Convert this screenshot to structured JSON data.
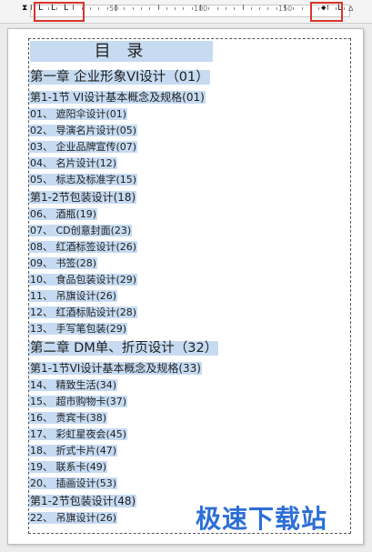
{
  "ruler": {
    "numbers": [
      "50",
      "100",
      "150"
    ]
  },
  "document": {
    "title": "目  录",
    "lines": [
      {
        "kind": "ch",
        "text": "第一章 企业形象VI设计（01）"
      },
      {
        "kind": "sec",
        "text": "第1-1节 VI设计基本概念及规格(01)"
      },
      {
        "kind": "it",
        "text": "01、 遮阳伞设计(01)"
      },
      {
        "kind": "it",
        "text": "02、 导演名片设计(05)"
      },
      {
        "kind": "it",
        "text": "03、 企业品牌宣传(07)"
      },
      {
        "kind": "it",
        "text": "04、 名片设计(12)"
      },
      {
        "kind": "it",
        "text": "05、 标志及标准字(15)"
      },
      {
        "kind": "sec",
        "text": "第1-2节包装设计(18)"
      },
      {
        "kind": "it",
        "text": "06、 酒瓶(19)"
      },
      {
        "kind": "it",
        "text": "07、 CD创意封面(23)"
      },
      {
        "kind": "it",
        "text": "08、 红酒标签设计(26)"
      },
      {
        "kind": "it",
        "text": "09、 书签(28)"
      },
      {
        "kind": "it",
        "text": "10、 食品包装设计(29)"
      },
      {
        "kind": "it",
        "text": "11、 吊旗设计(26)"
      },
      {
        "kind": "it",
        "text": "12、 红酒标贴设计(28)"
      },
      {
        "kind": "it",
        "text": "13、 手写笔包装(29)"
      },
      {
        "kind": "ch",
        "text": "第二章 DM单、折页设计（32）"
      },
      {
        "kind": "sec",
        "text": "第1-1节VI设计基本概念及规格(33)"
      },
      {
        "kind": "it",
        "text": "14、 精致生活(34)"
      },
      {
        "kind": "it",
        "text": "15、 超市购物卡(37)"
      },
      {
        "kind": "it",
        "text": "16、 贵宾卡(38)"
      },
      {
        "kind": "it",
        "text": "17、 彩虹星夜会(45)"
      },
      {
        "kind": "it",
        "text": "18、 折式卡片(47)"
      },
      {
        "kind": "it",
        "text": "19、 联系卡(49)"
      },
      {
        "kind": "it",
        "text": "20、 插画设计(53)"
      },
      {
        "kind": "sec",
        "text": "第1-2节包装设计(48)"
      },
      {
        "kind": "it",
        "text": "22、 吊旗设计(26)"
      }
    ]
  },
  "watermark": {
    "text": "极速下载站"
  },
  "colors": {
    "highlight": "#c6dbf2",
    "annotation": "#d9342b",
    "watermark": "#2d6fd6"
  }
}
